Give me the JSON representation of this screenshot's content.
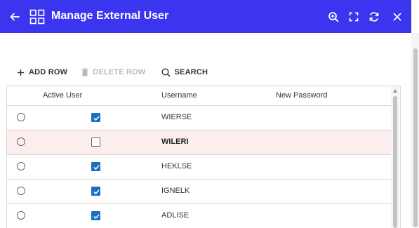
{
  "header": {
    "title": "Manage External User",
    "back_icon": "arrow-left-icon",
    "app_icon": "grid-icon",
    "actions": [
      "zoom-search-icon",
      "fullscreen-icon",
      "refresh-icon",
      "close-icon"
    ],
    "background": "#3b35f0"
  },
  "toolbar": {
    "add_label": "ADD ROW",
    "delete_label": "DELETE ROW",
    "search_label": "SEARCH"
  },
  "grid": {
    "columns": [
      "Active User",
      "Username",
      "New Password"
    ],
    "rows": [
      {
        "active": true,
        "username": "WIERSE",
        "new_password": ""
      },
      {
        "active": false,
        "username": "WILERI",
        "new_password": "",
        "highlighted": true
      },
      {
        "active": true,
        "username": "HEKLSE",
        "new_password": ""
      },
      {
        "active": true,
        "username": "IGNELK",
        "new_password": ""
      },
      {
        "active": true,
        "username": "ADLISE",
        "new_password": ""
      }
    ],
    "checkbox_color": "#1b6fc0",
    "highlight_color": "#fdeeee"
  }
}
